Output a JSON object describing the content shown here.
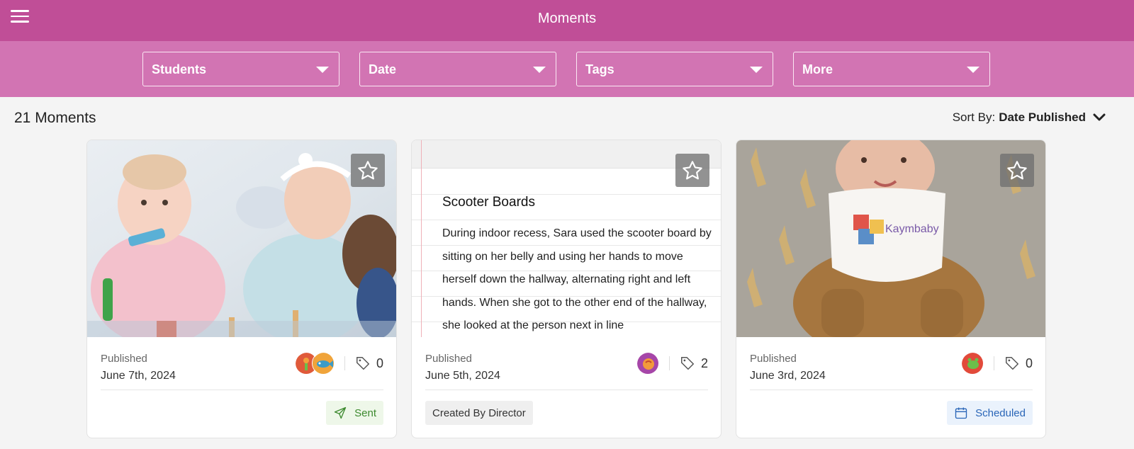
{
  "header": {
    "title": "Moments",
    "menu_icon": "hamburger-menu-icon",
    "color": "#c04e97"
  },
  "filters": [
    {
      "label": "Students"
    },
    {
      "label": "Date"
    },
    {
      "label": "Tags"
    },
    {
      "label": "More"
    }
  ],
  "summary": {
    "count_label": "21 Moments"
  },
  "sort": {
    "label": "Sort By:",
    "value": "Date Published",
    "icon": "chevron-down-icon"
  },
  "cards": [
    {
      "media": "photo",
      "media_desc": "two babies playing with toys",
      "published_label": "Published",
      "published_date": "June 7th, 2024",
      "tag_count": "0",
      "status": "Sent",
      "status_icon": "send-icon",
      "status_color": "#3d8a2f"
    },
    {
      "media": "note",
      "note_title": "Scooter Boards",
      "note_body": "During indoor recess, Sara used the scooter board by sitting on her belly and using her hands to move herself down the hallway, alternating right and left hands. When she got to the other end of the hallway, she looked at the person next in line",
      "published_label": "Published",
      "published_date": "June 5th, 2024",
      "tag_count": "2",
      "status": "Created By Director",
      "status_color": "#333333"
    },
    {
      "media": "photo",
      "media_desc": "smiling baby wearing bib",
      "bib_text": "Kaymbaby",
      "published_label": "Published",
      "published_date": "June 3rd, 2024",
      "tag_count": "0",
      "status": "Scheduled",
      "status_icon": "calendar-icon",
      "status_color": "#2a66b8"
    }
  ]
}
